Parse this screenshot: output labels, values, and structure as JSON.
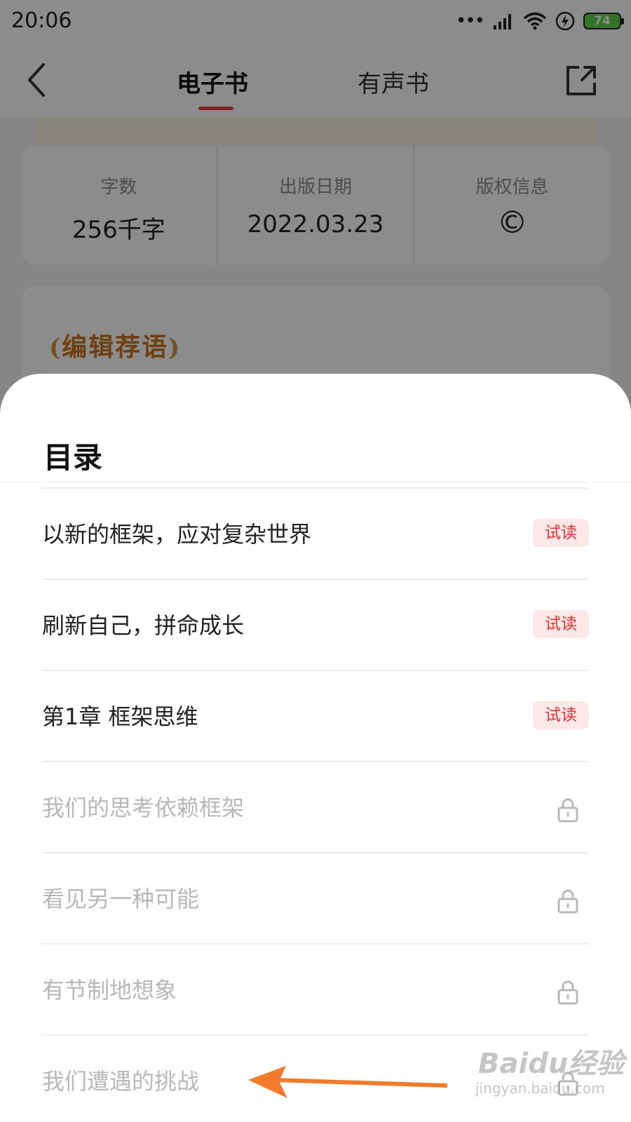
{
  "status_bar": {
    "time": "20:06",
    "battery": "74"
  },
  "nav": {
    "tabs": [
      {
        "label": "电子书",
        "active": true
      },
      {
        "label": "有声书",
        "active": false
      }
    ]
  },
  "book_info": {
    "word_count_label": "字数",
    "word_count_value": "256千字",
    "publish_date_label": "出版日期",
    "publish_date_value": "2022.03.23",
    "copyright_label": "版权信息",
    "copyright_value": "©"
  },
  "editor_section": {
    "title": "编辑荐语"
  },
  "toc": {
    "title": "目录",
    "items": [
      {
        "title": "以新的框架，应对复杂世界",
        "badge": "试读",
        "locked": false
      },
      {
        "title": "刷新自己，拼命成长",
        "badge": "试读",
        "locked": false
      },
      {
        "title": "第1章 框架思维",
        "badge": "试读",
        "locked": false
      },
      {
        "title": "我们的思考依赖框架",
        "locked": true
      },
      {
        "title": "看见另一种可能",
        "locked": true
      },
      {
        "title": "有节制地想象",
        "locked": true
      },
      {
        "title": "我们遭遇的挑战",
        "locked": true
      }
    ]
  },
  "watermark": {
    "logo": "Baidu经验",
    "url": "jingyan.baidu.com"
  },
  "colors": {
    "accent": "#e33b3b",
    "trial_badge_bg": "#fde8e8",
    "annotation_arrow": "#f27b2b"
  }
}
